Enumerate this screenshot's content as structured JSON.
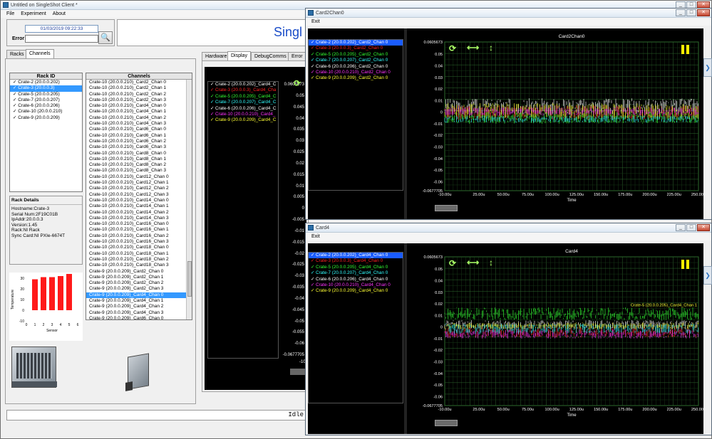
{
  "main_window": {
    "title": "Untitled on SingleShot Client *",
    "menu": [
      "File",
      "Experiment",
      "About"
    ],
    "timestamp": "01/03/2019 09:22:33",
    "error_label": "Error",
    "app_title": "Singl",
    "status": "Idle"
  },
  "left_tabs": [
    "Racks",
    "Channels"
  ],
  "rack_list": {
    "header": "Rack ID",
    "items": [
      "Crate-2 (20.0.0.202)",
      "Crate-3 (20.0.0.3)",
      "Crate-5 (20.0.0.205)",
      "Crate-7 (20.0.0.207)",
      "Crate-6 (20.0.0.206)",
      "Crate-10 (20.0.0.210)",
      "Crate-9 (20.0.0.209)"
    ],
    "selected": 1
  },
  "rack_details": {
    "header": "Rack Details",
    "lines": [
      "Hostname:Crate-3",
      "Serial Num:2F19C01B",
      "IpAddr:20.0.0.3",
      "Version:1.45",
      "Rack:NI Rack",
      "Sync Card:NI PXIe-6674T"
    ]
  },
  "mini_chart": {
    "ylabel": "Temperature",
    "xlabel": "Sensor",
    "yticks": [
      "30",
      "20",
      "10",
      "0",
      "-10"
    ],
    "xticks": [
      "0",
      "1",
      "2",
      "3",
      "4",
      "5",
      "6"
    ],
    "values": [
      29,
      31,
      31,
      32,
      34
    ]
  },
  "channel_list": {
    "header": "Channels",
    "items": [
      "Crate-10 (20.0.0.210)_Card2_Chan 0",
      "Crate-10 (20.0.0.210)_Card2_Chan 1",
      "Crate-10 (20.0.0.210)_Card2_Chan 2",
      "Crate-10 (20.0.0.210)_Card2_Chan 3",
      "Crate-10 (20.0.0.210)_Card4_Chan 0",
      "Crate-10 (20.0.0.210)_Card4_Chan 1",
      "Crate-10 (20.0.0.210)_Card4_Chan 2",
      "Crate-10 (20.0.0.210)_Card4_Chan 3",
      "Crate-10 (20.0.0.210)_Card6_Chan 0",
      "Crate-10 (20.0.0.210)_Card6_Chan 1",
      "Crate-10 (20.0.0.210)_Card6_Chan 2",
      "Crate-10 (20.0.0.210)_Card6_Chan 3",
      "Crate-10 (20.0.0.210)_Card8_Chan 0",
      "Crate-10 (20.0.0.210)_Card8_Chan 1",
      "Crate-10 (20.0.0.210)_Card8_Chan 2",
      "Crate-10 (20.0.0.210)_Card8_Chan 3",
      "Crate-10 (20.0.0.210)_Card12_Chan 0",
      "Crate-10 (20.0.0.210)_Card12_Chan 1",
      "Crate-10 (20.0.0.210)_Card12_Chan 2",
      "Crate-10 (20.0.0.210)_Card12_Chan 3",
      "Crate-10 (20.0.0.210)_Card14_Chan 0",
      "Crate-10 (20.0.0.210)_Card14_Chan 1",
      "Crate-10 (20.0.0.210)_Card14_Chan 2",
      "Crate-10 (20.0.0.210)_Card14_Chan 3",
      "Crate-10 (20.0.0.210)_Card16_Chan 0",
      "Crate-10 (20.0.0.210)_Card16_Chan 1",
      "Crate-10 (20.0.0.210)_Card16_Chan 2",
      "Crate-10 (20.0.0.210)_Card16_Chan 3",
      "Crate-10 (20.0.0.210)_Card18_Chan 0",
      "Crate-10 (20.0.0.210)_Card18_Chan 1",
      "Crate-10 (20.0.0.210)_Card18_Chan 2",
      "Crate-10 (20.0.0.210)_Card18_Chan 3",
      "Crate-9 (20.0.0.209)_Card2_Chan 0",
      "Crate-9 (20.0.0.209)_Card2_Chan 1",
      "Crate-9 (20.0.0.209)_Card2_Chan 2",
      "Crate-9 (20.0.0.209)_Card2_Chan 3",
      "Crate-9 (20.0.0.209)_Card4_Chan 0",
      "Crate-9 (20.0.0.209)_Card4_Chan 1",
      "Crate-9 (20.0.0.209)_Card4_Chan 2",
      "Crate-9 (20.0.0.209)_Card4_Chan 3",
      "Crate-9 (20.0.0.209)_Card6_Chan 0",
      "Crate-9 (20.0.0.209)_Card6_Chan 1"
    ],
    "selected": 36
  },
  "right_tabs": [
    "Hardware",
    "Display",
    "DebugComms",
    "Error"
  ],
  "display_legend": [
    "Crate-2 (20.0.0.202)_Card4_C",
    "Crate-3 (20.0.0.3)_Card4_Cha",
    "Crate-5 (20.0.0.205)_Card4_C",
    "Crate-7 (20.0.0.207)_Card4_C",
    "Crate-6 (20.0.0.206)_Card4_C",
    "Crate-10 (20.0.0.210)_Card4_",
    "Crate-9 (20.0.0.209)_Card4_C"
  ],
  "display_yticks": [
    "0.0605673",
    "0.05",
    "0.045",
    "0.04",
    "0.035",
    "0.03",
    "0.025",
    "0.02",
    "0.015",
    "0.01",
    "0.005",
    "0",
    "-0.005",
    "-0.01",
    "-0.015",
    "-0.02",
    "-0.025",
    "-0.03",
    "-0.035",
    "-0.04",
    "-0.045",
    "-0.05",
    "-0.055",
    "-0.06",
    "-0.0677705"
  ],
  "display_xfirst": "-10.",
  "colors": {
    "crate2": "#ffffff",
    "crate3": "#ff2020",
    "crate5": "#33ff33",
    "crate7": "#33ffff",
    "crate6": "#ffffff",
    "crate10": "#ff33ff",
    "crate9": "#ffff33"
  },
  "win_card2": {
    "title": "Card2Chan0",
    "menu": "Exit",
    "chart_title": "Card2Chan0",
    "legend": [
      "Crate-2 (20.0.0.202)_Card2_Chan 0",
      "Crate-3 (20.0.0.3)_Card2_Chan 0",
      "Crate-5 (20.0.0.205)_Card2_Chan 0",
      "Crate-7 (20.0.0.207)_Card2_Chan 0",
      "Crate-6 (20.0.0.206)_Card2_Chan 0",
      "Crate-10 (20.0.0.210)_Card2_Chan 0",
      "Crate-9 (20.0.0.209)_Card2_Chan 0"
    ],
    "xlabel": "Time",
    "annotation": ""
  },
  "win_card4": {
    "title": "Card4",
    "menu": "Exit",
    "chart_title": "Card4",
    "legend": [
      "Crate-2 (20.0.0.202)_Card4_Chan 0",
      "Crate-3 (20.0.0.3)_Card4_Chan 0",
      "Crate-5 (20.0.0.205)_Card4_Chan 0",
      "Crate-7 (20.0.0.207)_Card4_Chan 0",
      "Crate-6 (20.0.0.206)_Card4_Chan 0",
      "Crate-10 (20.0.0.210)_Card4_Chan 0",
      "Crate-9 (20.0.0.209)_Card4_Chan 0"
    ],
    "xlabel": "Time",
    "annotation": "Crate-5 (20.0.0.205)_Card4_Chan 1"
  },
  "plot_yticks": [
    "0.0605673",
    "0.05",
    "0.04",
    "0.03",
    "0.02",
    "0.01",
    "0",
    "-0.01",
    "-0.02",
    "-0.03",
    "-0.04",
    "-0.05",
    "-0.06",
    "-0.0677705"
  ],
  "plot_xticks": [
    "-10.00u",
    "25.00u",
    "50.00u",
    "75.00u",
    "100.00u",
    "125.00u",
    "150.00u",
    "175.00u",
    "200.00u",
    "225.00u",
    "250.00u"
  ]
}
